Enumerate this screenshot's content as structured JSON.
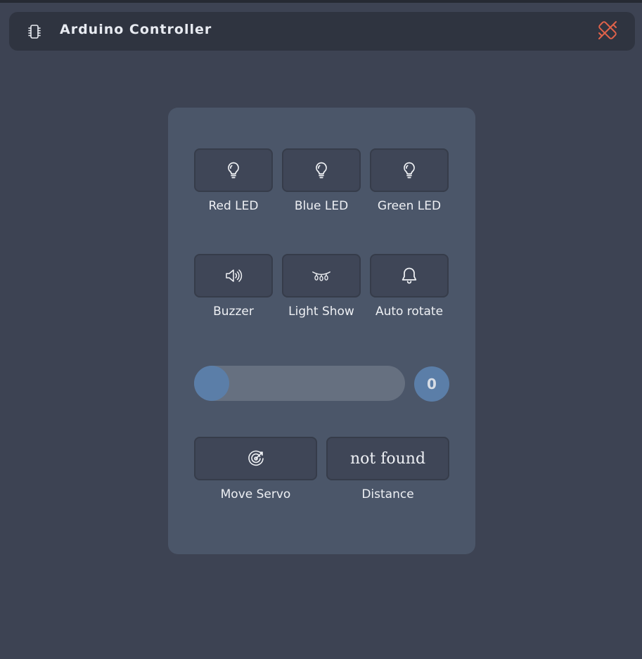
{
  "header": {
    "title": "Arduino Controller",
    "chip_icon": "chip-icon",
    "disconnect_icon": "disconnect-icon",
    "disconnect_color": "#e0624a"
  },
  "controls": {
    "red_led": {
      "label": "Red LED",
      "icon": "bulb-icon"
    },
    "blue_led": {
      "label": "Blue LED",
      "icon": "bulb-icon"
    },
    "green_led": {
      "label": "Green LED",
      "icon": "bulb-icon"
    },
    "buzzer": {
      "label": "Buzzer",
      "icon": "speaker-icon"
    },
    "light_show": {
      "label": "Light Show",
      "icon": "string-lights-icon"
    },
    "auto_rotate": {
      "label": "Auto rotate",
      "icon": "bell-icon"
    }
  },
  "slider": {
    "value": "0"
  },
  "servo": {
    "label": "Move Servo",
    "icon": "radar-icon"
  },
  "distance": {
    "label": "Distance",
    "value": "not found"
  },
  "colors": {
    "background": "#3d4353",
    "panel": "#4b5669",
    "accent": "#5b7ea8"
  }
}
